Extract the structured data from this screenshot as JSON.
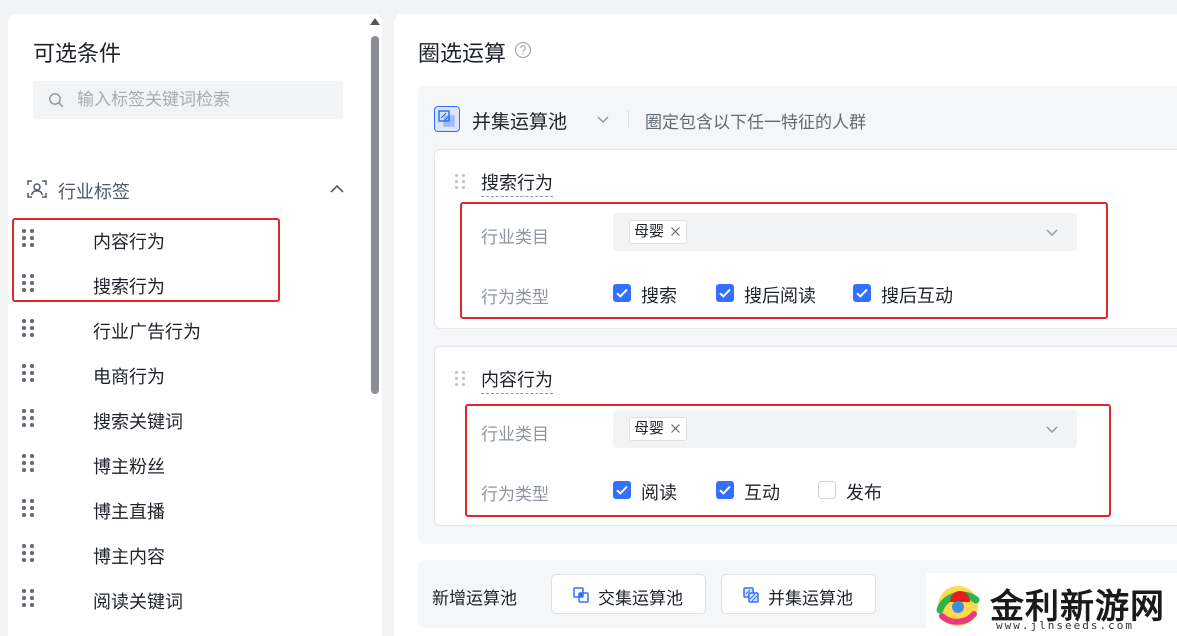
{
  "left_panel": {
    "title": "可选条件",
    "search": {
      "placeholder": "输入标签关键词检索"
    },
    "group": {
      "label": "行业标签"
    },
    "items": [
      {
        "label": "内容行为"
      },
      {
        "label": "搜索行为"
      },
      {
        "label": "行业广告行为"
      },
      {
        "label": "电商行为"
      },
      {
        "label": "搜索关键词"
      },
      {
        "label": "博主粉丝"
      },
      {
        "label": "博主直播"
      },
      {
        "label": "博主内容"
      },
      {
        "label": "阅读关键词"
      }
    ]
  },
  "right_panel": {
    "title": "圈选运算",
    "pool": {
      "title": "并集运算池",
      "description": "圈定包含以下任一特征的人群",
      "cards": [
        {
          "title": "搜索行为",
          "industry_label": "行业类目",
          "industry_tag": "母婴",
          "behavior_label": "行为类型",
          "options": [
            {
              "label": "搜索",
              "checked": true
            },
            {
              "label": "搜后阅读",
              "checked": true
            },
            {
              "label": "搜后互动",
              "checked": true
            }
          ]
        },
        {
          "title": "内容行为",
          "industry_label": "行业类目",
          "industry_tag": "母婴",
          "behavior_label": "行为类型",
          "options": [
            {
              "label": "阅读",
              "checked": true
            },
            {
              "label": "互动",
              "checked": true
            },
            {
              "label": "发布",
              "checked": false
            }
          ]
        }
      ]
    },
    "bottom": {
      "label": "新增运算池",
      "intersection_button": "交集运算池",
      "union_button": "并集运算池"
    }
  },
  "watermark": {
    "text": "金利新游网",
    "url": "www.jlnseeds.com"
  },
  "colors": {
    "accent": "#3370ff",
    "highlight_box": "#e0262b"
  }
}
